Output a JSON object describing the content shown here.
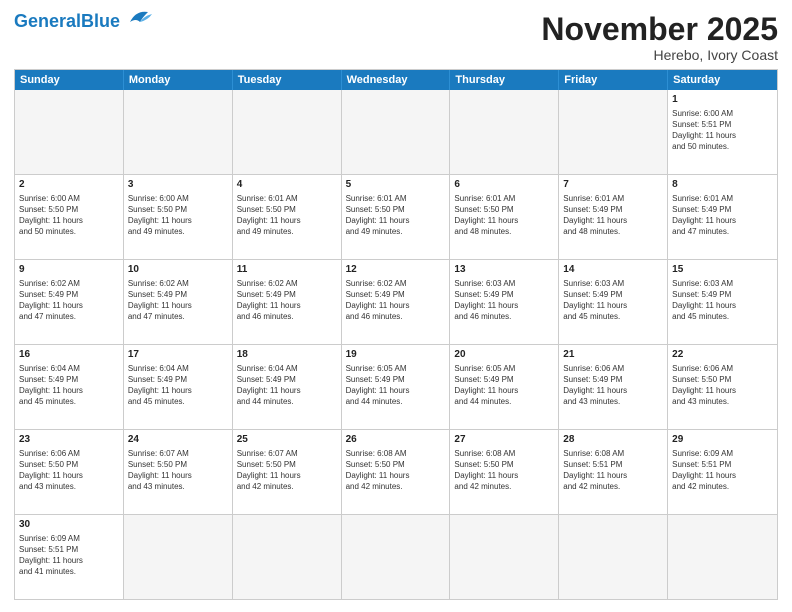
{
  "header": {
    "logo_general": "General",
    "logo_blue": "Blue",
    "month_title": "November 2025",
    "location": "Herebo, Ivory Coast"
  },
  "weekdays": [
    "Sunday",
    "Monday",
    "Tuesday",
    "Wednesday",
    "Thursday",
    "Friday",
    "Saturday"
  ],
  "rows": [
    [
      {
        "day": "",
        "info": ""
      },
      {
        "day": "",
        "info": ""
      },
      {
        "day": "",
        "info": ""
      },
      {
        "day": "",
        "info": ""
      },
      {
        "day": "",
        "info": ""
      },
      {
        "day": "",
        "info": ""
      },
      {
        "day": "1",
        "info": "Sunrise: 6:00 AM\nSunset: 5:51 PM\nDaylight: 11 hours\nand 50 minutes."
      }
    ],
    [
      {
        "day": "2",
        "info": "Sunrise: 6:00 AM\nSunset: 5:50 PM\nDaylight: 11 hours\nand 50 minutes."
      },
      {
        "day": "3",
        "info": "Sunrise: 6:00 AM\nSunset: 5:50 PM\nDaylight: 11 hours\nand 49 minutes."
      },
      {
        "day": "4",
        "info": "Sunrise: 6:01 AM\nSunset: 5:50 PM\nDaylight: 11 hours\nand 49 minutes."
      },
      {
        "day": "5",
        "info": "Sunrise: 6:01 AM\nSunset: 5:50 PM\nDaylight: 11 hours\nand 49 minutes."
      },
      {
        "day": "6",
        "info": "Sunrise: 6:01 AM\nSunset: 5:50 PM\nDaylight: 11 hours\nand 48 minutes."
      },
      {
        "day": "7",
        "info": "Sunrise: 6:01 AM\nSunset: 5:49 PM\nDaylight: 11 hours\nand 48 minutes."
      },
      {
        "day": "8",
        "info": "Sunrise: 6:01 AM\nSunset: 5:49 PM\nDaylight: 11 hours\nand 47 minutes."
      }
    ],
    [
      {
        "day": "9",
        "info": "Sunrise: 6:02 AM\nSunset: 5:49 PM\nDaylight: 11 hours\nand 47 minutes."
      },
      {
        "day": "10",
        "info": "Sunrise: 6:02 AM\nSunset: 5:49 PM\nDaylight: 11 hours\nand 47 minutes."
      },
      {
        "day": "11",
        "info": "Sunrise: 6:02 AM\nSunset: 5:49 PM\nDaylight: 11 hours\nand 46 minutes."
      },
      {
        "day": "12",
        "info": "Sunrise: 6:02 AM\nSunset: 5:49 PM\nDaylight: 11 hours\nand 46 minutes."
      },
      {
        "day": "13",
        "info": "Sunrise: 6:03 AM\nSunset: 5:49 PM\nDaylight: 11 hours\nand 46 minutes."
      },
      {
        "day": "14",
        "info": "Sunrise: 6:03 AM\nSunset: 5:49 PM\nDaylight: 11 hours\nand 45 minutes."
      },
      {
        "day": "15",
        "info": "Sunrise: 6:03 AM\nSunset: 5:49 PM\nDaylight: 11 hours\nand 45 minutes."
      }
    ],
    [
      {
        "day": "16",
        "info": "Sunrise: 6:04 AM\nSunset: 5:49 PM\nDaylight: 11 hours\nand 45 minutes."
      },
      {
        "day": "17",
        "info": "Sunrise: 6:04 AM\nSunset: 5:49 PM\nDaylight: 11 hours\nand 45 minutes."
      },
      {
        "day": "18",
        "info": "Sunrise: 6:04 AM\nSunset: 5:49 PM\nDaylight: 11 hours\nand 44 minutes."
      },
      {
        "day": "19",
        "info": "Sunrise: 6:05 AM\nSunset: 5:49 PM\nDaylight: 11 hours\nand 44 minutes."
      },
      {
        "day": "20",
        "info": "Sunrise: 6:05 AM\nSunset: 5:49 PM\nDaylight: 11 hours\nand 44 minutes."
      },
      {
        "day": "21",
        "info": "Sunrise: 6:06 AM\nSunset: 5:49 PM\nDaylight: 11 hours\nand 43 minutes."
      },
      {
        "day": "22",
        "info": "Sunrise: 6:06 AM\nSunset: 5:50 PM\nDaylight: 11 hours\nand 43 minutes."
      }
    ],
    [
      {
        "day": "23",
        "info": "Sunrise: 6:06 AM\nSunset: 5:50 PM\nDaylight: 11 hours\nand 43 minutes."
      },
      {
        "day": "24",
        "info": "Sunrise: 6:07 AM\nSunset: 5:50 PM\nDaylight: 11 hours\nand 43 minutes."
      },
      {
        "day": "25",
        "info": "Sunrise: 6:07 AM\nSunset: 5:50 PM\nDaylight: 11 hours\nand 42 minutes."
      },
      {
        "day": "26",
        "info": "Sunrise: 6:08 AM\nSunset: 5:50 PM\nDaylight: 11 hours\nand 42 minutes."
      },
      {
        "day": "27",
        "info": "Sunrise: 6:08 AM\nSunset: 5:50 PM\nDaylight: 11 hours\nand 42 minutes."
      },
      {
        "day": "28",
        "info": "Sunrise: 6:08 AM\nSunset: 5:51 PM\nDaylight: 11 hours\nand 42 minutes."
      },
      {
        "day": "29",
        "info": "Sunrise: 6:09 AM\nSunset: 5:51 PM\nDaylight: 11 hours\nand 42 minutes."
      }
    ],
    [
      {
        "day": "30",
        "info": "Sunrise: 6:09 AM\nSunset: 5:51 PM\nDaylight: 11 hours\nand 41 minutes."
      },
      {
        "day": "",
        "info": ""
      },
      {
        "day": "",
        "info": ""
      },
      {
        "day": "",
        "info": ""
      },
      {
        "day": "",
        "info": ""
      },
      {
        "day": "",
        "info": ""
      },
      {
        "day": "",
        "info": ""
      }
    ]
  ]
}
